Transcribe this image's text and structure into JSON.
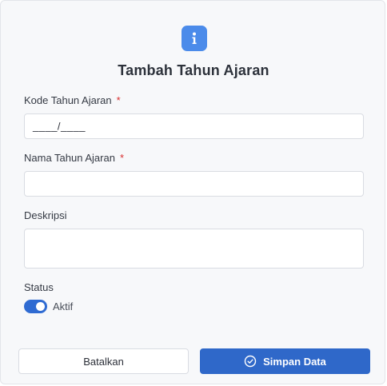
{
  "dialog": {
    "title": "Tambah Tahun Ajaran",
    "icon": "info-icon",
    "accent_color": "#4b8bea"
  },
  "form": {
    "kode": {
      "label": "Kode Tahun Ajaran",
      "required_mark": "*",
      "value": "____/____"
    },
    "nama": {
      "label": "Nama Tahun Ajaran",
      "required_mark": "*",
      "value": ""
    },
    "deskripsi": {
      "label": "Deskripsi",
      "value": ""
    },
    "status": {
      "label": "Status",
      "toggle_label": "Aktif",
      "enabled": true
    }
  },
  "actions": {
    "cancel_label": "Batalkan",
    "save_label": "Simpan Data",
    "save_icon": "check-circle-icon",
    "primary_color": "#2f68c9"
  }
}
